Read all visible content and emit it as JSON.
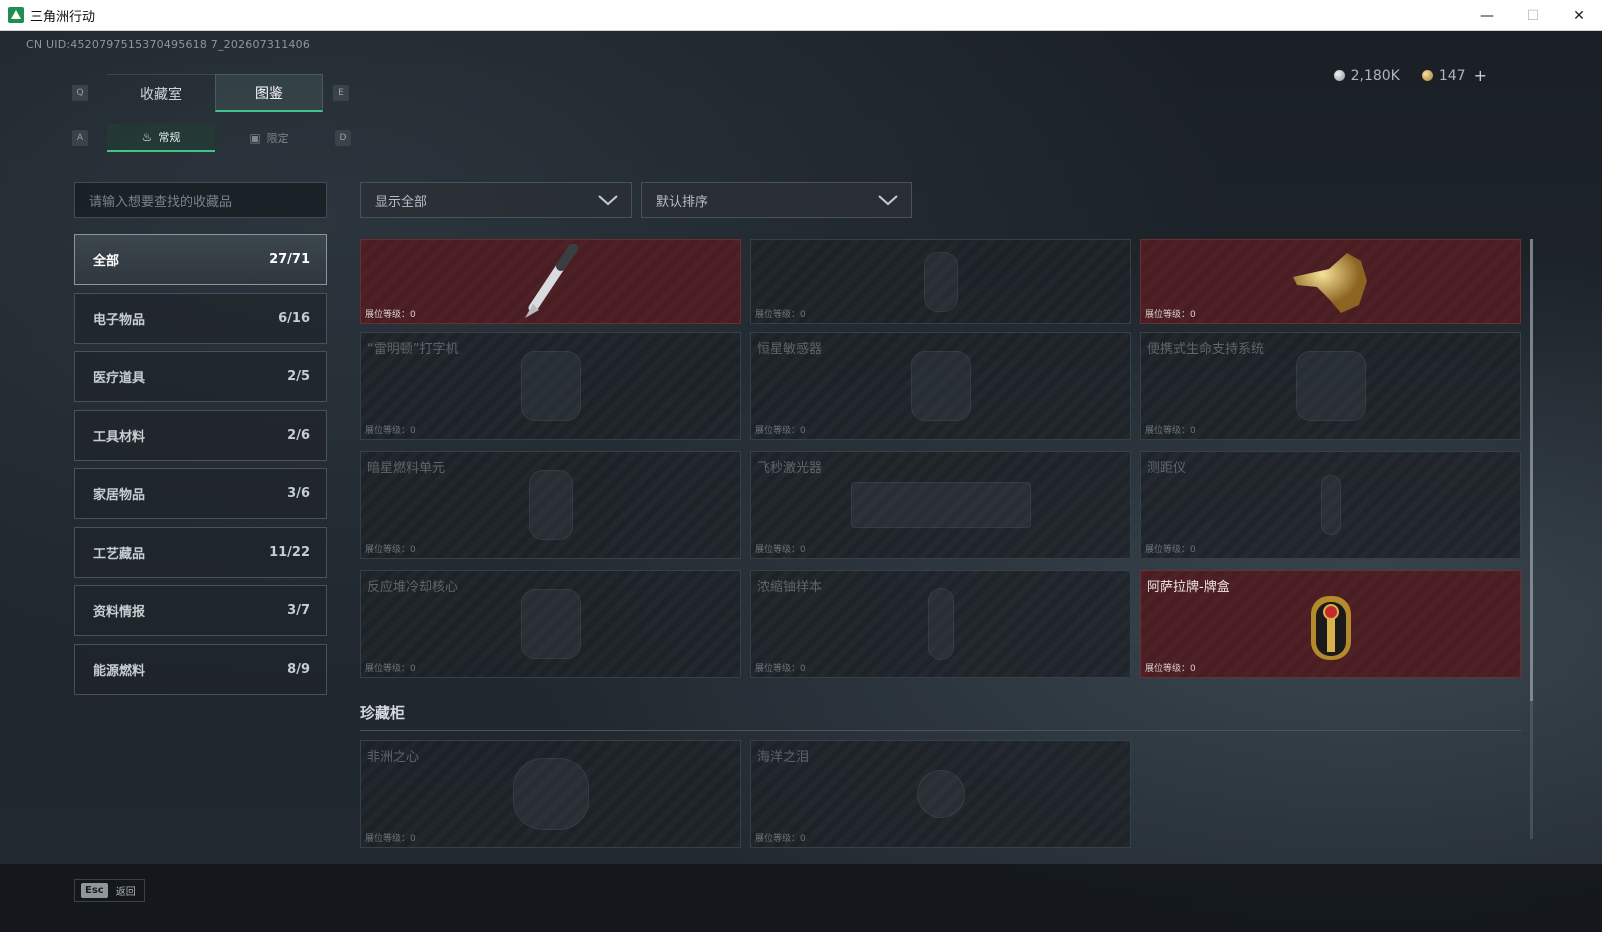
{
  "window": {
    "title": "三角洲行动",
    "minimize": "—",
    "maximize": "☐",
    "close": "✕"
  },
  "uid": "CN UID:4520797515370495618 7_202607311406",
  "currency": {
    "silver": "2,180K",
    "gold": "147",
    "add": "+"
  },
  "keys": {
    "q": "Q",
    "e": "E",
    "a": "A",
    "d": "D"
  },
  "tabs_main": [
    {
      "label": "收藏室",
      "active": false
    },
    {
      "label": "图鉴",
      "active": true
    }
  ],
  "tabs_sub": [
    {
      "label": "常规",
      "icon": "flame-icon",
      "active": true
    },
    {
      "label": "限定",
      "icon": "image-icon",
      "active": false
    }
  ],
  "search": {
    "placeholder": "请输入想要查找的收藏品"
  },
  "filters": {
    "display": "显示全部",
    "sort": "默认排序"
  },
  "categories": [
    {
      "label": "全部",
      "count": "27/71"
    },
    {
      "label": "电子物品",
      "count": "6/16"
    },
    {
      "label": "医疗道具",
      "count": "2/5"
    },
    {
      "label": "工具材料",
      "count": "2/6"
    },
    {
      "label": "家居物品",
      "count": "3/6"
    },
    {
      "label": "工艺藏品",
      "count": "11/22"
    },
    {
      "label": "资料情报",
      "count": "3/7"
    },
    {
      "label": "能源燃料",
      "count": "8/9"
    }
  ],
  "level_label": "展位等级：0",
  "items": [
    {
      "name": "",
      "owned": true,
      "icon": "fountain-pen-icon"
    },
    {
      "name": "",
      "owned": false,
      "icon": "vase-icon"
    },
    {
      "name": "",
      "owned": true,
      "icon": "golden-crocodile-icon"
    },
    {
      "name": "“雷明顿”打字机",
      "owned": false,
      "icon": "typewriter-icon"
    },
    {
      "name": "恒星敏感器",
      "owned": false,
      "icon": "sensor-icon"
    },
    {
      "name": "便携式生命支持系统",
      "owned": false,
      "icon": "life-support-icon"
    },
    {
      "name": "暗星燃料单元",
      "owned": false,
      "icon": "fuel-cell-icon"
    },
    {
      "name": "飞秒激光器",
      "owned": false,
      "icon": "laser-icon"
    },
    {
      "name": "测距仪",
      "owned": false,
      "icon": "rangefinder-icon"
    },
    {
      "name": "反应堆冷却核心",
      "owned": false,
      "icon": "reactor-core-icon"
    },
    {
      "name": "浓缩铀样本",
      "owned": false,
      "icon": "uranium-sample-icon"
    },
    {
      "name": "阿萨拉牌-牌盒",
      "owned": true,
      "icon": "card-box-icon"
    }
  ],
  "treasure": {
    "title": "珍藏柜",
    "items": [
      {
        "name": "非洲之心",
        "owned": false,
        "icon": "diamond-icon"
      },
      {
        "name": "海洋之泪",
        "owned": false,
        "icon": "pearl-icon"
      }
    ]
  },
  "footer": {
    "esc_key": "Esc",
    "esc_label": "返回"
  }
}
